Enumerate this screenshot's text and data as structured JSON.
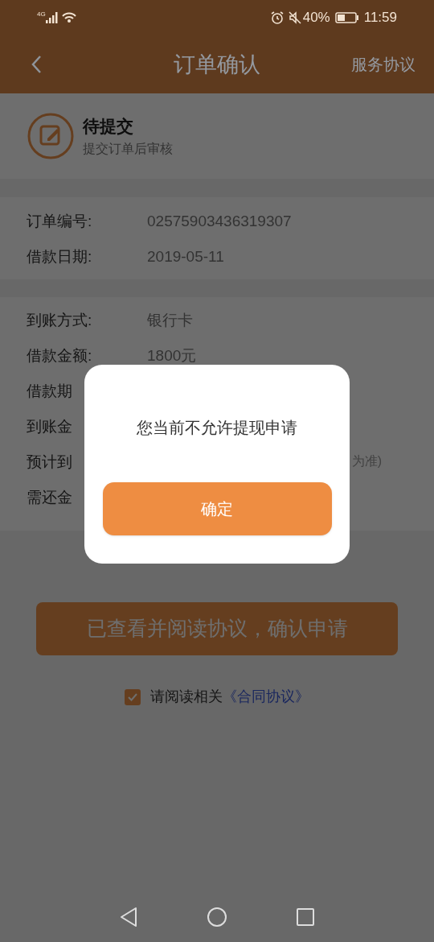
{
  "status_bar": {
    "network": "4G",
    "battery": "40%",
    "time": "11:59"
  },
  "header": {
    "title": "订单确认",
    "action": "服务协议"
  },
  "order_status": {
    "title": "待提交",
    "subtitle": "提交订单后审核"
  },
  "order_info": [
    {
      "label": "订单编号:",
      "value": "02575903436319307"
    },
    {
      "label": "借款日期:",
      "value": "2019-05-11"
    }
  ],
  "details": [
    {
      "label": "到账方式:",
      "value": "银行卡"
    },
    {
      "label": "借款金额:",
      "value": "1800元"
    },
    {
      "label": "借款期"
    },
    {
      "label": "到账金"
    },
    {
      "label": "预计到",
      "value_tail": "为准)"
    },
    {
      "label": "需还金"
    }
  ],
  "confirm_button": "已查看并阅读协议，确认申请",
  "agreement": {
    "checked": true,
    "text": "请阅读相关",
    "link": "《合同协议》"
  },
  "dialog": {
    "message": "您当前不允许提现申请",
    "button": "确定"
  }
}
